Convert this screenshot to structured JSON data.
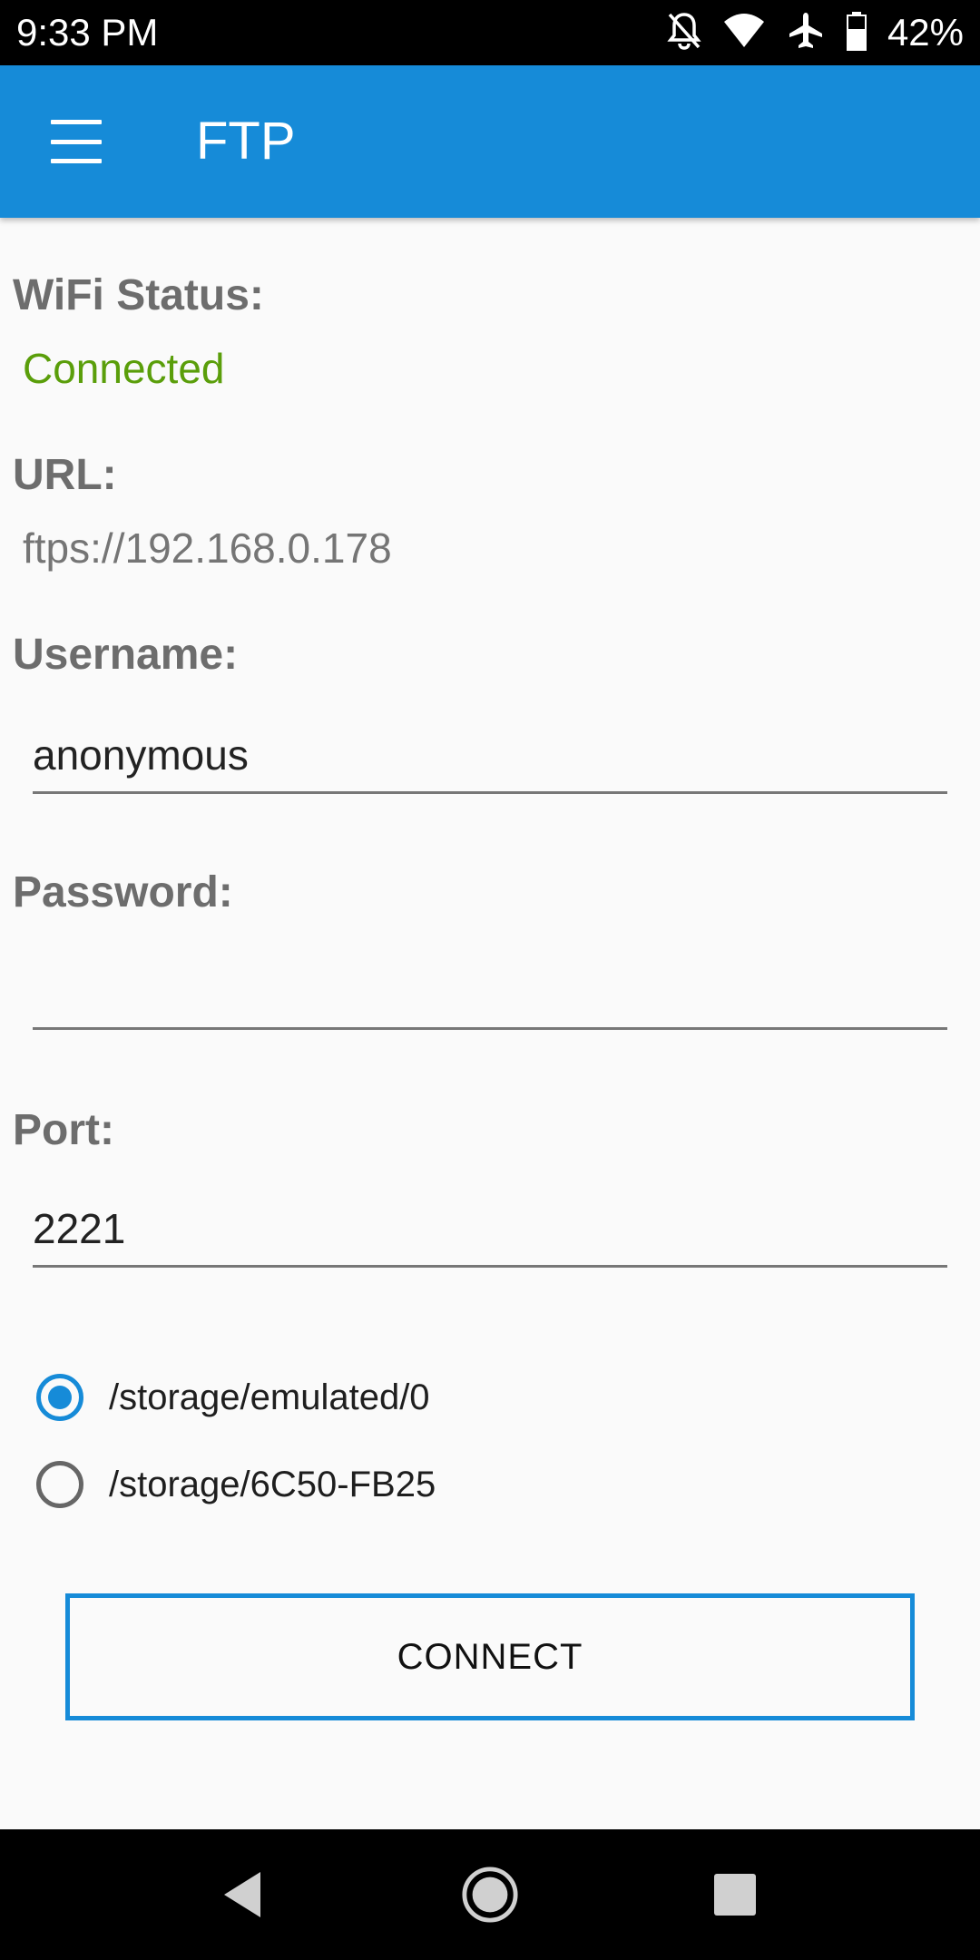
{
  "status_bar": {
    "time": "9:33 PM",
    "battery": "42%",
    "icons": [
      "notifications-off-icon",
      "wifi-icon",
      "airplane-icon",
      "battery-icon"
    ]
  },
  "app_bar": {
    "title": "FTP",
    "menu_icon": "menu-icon"
  },
  "wifi": {
    "label": "WiFi Status:",
    "value": "Connected",
    "value_color": "#5a9e0a"
  },
  "url": {
    "label": "URL:",
    "value": "ftps://192.168.0.178"
  },
  "username": {
    "label": "Username:",
    "value": "anonymous"
  },
  "password": {
    "label": "Password:",
    "value": ""
  },
  "port": {
    "label": "Port:",
    "value": "2221"
  },
  "storage_options": [
    {
      "label": "/storage/emulated/0",
      "selected": true
    },
    {
      "label": "/storage/6C50-FB25",
      "selected": false
    }
  ],
  "connect_button": {
    "label": "CONNECT"
  },
  "nav_bar": {
    "icons": [
      "back-icon",
      "home-icon",
      "recents-icon"
    ]
  },
  "colors": {
    "accent": "#168bd8",
    "label_gray": "#6d6d6d"
  }
}
